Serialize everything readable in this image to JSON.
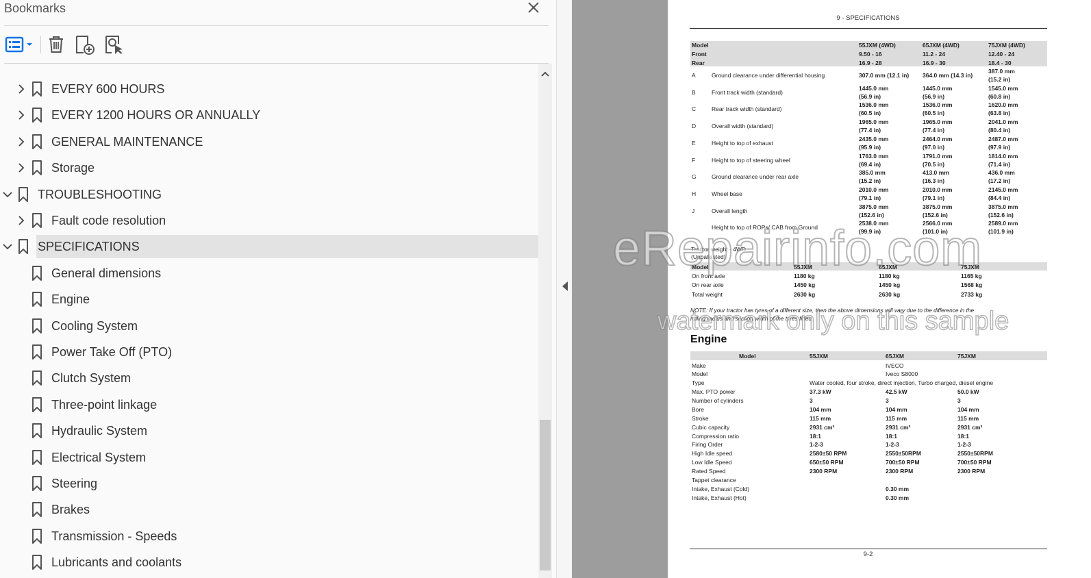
{
  "panel": {
    "title": "Bookmarks",
    "toolbar": {
      "options_icon": "list-options-icon",
      "delete_icon": "trash-icon",
      "new_bookmark_icon": "add-bookmark-icon",
      "find_bookmark_icon": "find-bookmark-icon"
    }
  },
  "bookmarks": [
    {
      "label": "EVERY 600 HOURS",
      "level": 1,
      "expandable": true,
      "expanded": false
    },
    {
      "label": "EVERY 1200 HOURS OR ANNUALLY",
      "level": 1,
      "expandable": true,
      "expanded": false
    },
    {
      "label": "GENERAL MAINTENANCE",
      "level": 1,
      "expandable": true,
      "expanded": false
    },
    {
      "label": "Storage",
      "level": 1,
      "expandable": true,
      "expanded": false
    },
    {
      "label": "TROUBLESHOOTING",
      "level": 0,
      "expandable": true,
      "expanded": true
    },
    {
      "label": "Fault code resolution",
      "level": 1,
      "expandable": true,
      "expanded": false
    },
    {
      "label": "SPECIFICATIONS",
      "level": 0,
      "expandable": true,
      "expanded": true,
      "selected": true
    },
    {
      "label": "General dimensions",
      "level": 1,
      "expandable": false
    },
    {
      "label": "Engine",
      "level": 1,
      "expandable": false
    },
    {
      "label": "Cooling System",
      "level": 1,
      "expandable": false
    },
    {
      "label": "Power Take Off (PTO)",
      "level": 1,
      "expandable": false
    },
    {
      "label": "Clutch System",
      "level": 1,
      "expandable": false
    },
    {
      "label": "Three-point linkage",
      "level": 1,
      "expandable": false
    },
    {
      "label": "Hydraulic System",
      "level": 1,
      "expandable": false
    },
    {
      "label": "Electrical System",
      "level": 1,
      "expandable": false
    },
    {
      "label": "Steering",
      "level": 1,
      "expandable": false
    },
    {
      "label": "Brakes",
      "level": 1,
      "expandable": false
    },
    {
      "label": "Transmission - Speeds",
      "level": 1,
      "expandable": false
    },
    {
      "label": "Lubricants and coolants",
      "level": 1,
      "expandable": false
    }
  ],
  "document": {
    "header": "9 - SPECIFICATIONS",
    "footer": "9-2",
    "dimensions": {
      "head_rows": [
        [
          "Model",
          "55JXM (4WD)",
          "65JXM (4WD)",
          "75JXM (4WD)"
        ],
        [
          "Front",
          "9.50 - 16",
          "11.2 - 24",
          "12.40 - 24"
        ],
        [
          "Rear",
          "16.9 - 28",
          "16.9 - 30",
          "18.4 - 30"
        ]
      ],
      "rows": [
        {
          "key": "A",
          "name": "Ground clearance under differential housing",
          "v1": "307.0 mm (12.1 in)",
          "v2": "364.0 mm (14.3 in)",
          "v3": "387.0 mm",
          "v3b": "(15.2 in)"
        },
        {
          "key": "B",
          "name": "Front track width (standard)",
          "v1": "1445.0 mm",
          "v1b": "(56.9 in)",
          "v2": "1445.0 mm",
          "v2b": "(56.9 in)",
          "v3": "1545.0 mm",
          "v3b": "(60.8 in)"
        },
        {
          "key": "C",
          "name": "Rear track width (standard)",
          "v1": "1536.0 mm",
          "v1b": "(60.5 in)",
          "v2": "1536.0 mm",
          "v2b": "(60.5 in)",
          "v3": "1620.0 mm",
          "v3b": "(63.8 in)"
        },
        {
          "key": "D",
          "name": "Overall width (standard)",
          "v1": "1965.0 mm",
          "v1b": "(77.4 in)",
          "v2": "1965.0 mm",
          "v2b": "(77.4 in)",
          "v3": "2041.0 mm",
          "v3b": "(80.4 in)"
        },
        {
          "key": "E",
          "name": "Height to top of exhaust",
          "v1": "2435.0 mm",
          "v1b": "(95.9 in)",
          "v2": "2464.0 mm",
          "v2b": "(97.0 in)",
          "v3": "2487.0 mm",
          "v3b": "(97.9 in)"
        },
        {
          "key": "F",
          "name": "Height to top of steering wheel",
          "v1": "1763.0 mm",
          "v1b": "(69.4 in)",
          "v2": "1791.0 mm",
          "v2b": "(70.5 in)",
          "v3": "1814.0 mm",
          "v3b": "(71.4 in)"
        },
        {
          "key": "G",
          "name": "Ground clearance under rear axle",
          "v1": "385.0 mm",
          "v1b": "(15.2 in)",
          "v2": "413.0 mm",
          "v2b": "(16.3 in)",
          "v3": "436.0 mm",
          "v3b": "(17.2 in)"
        },
        {
          "key": "H",
          "name": "Wheel base",
          "v1": "2010.0 mm",
          "v1b": "(79.1 in)",
          "v2": "2010.0 mm",
          "v2b": "(79.1 in)",
          "v3": "2145.0 mm",
          "v3b": "(84.4 in)"
        },
        {
          "key": "J",
          "name": "Overall length",
          "v1": "3875.0 mm",
          "v1b": "(152.6 in)",
          "v2": "3875.0 mm",
          "v2b": "(152.6 in)",
          "v3": "3875.0 mm",
          "v3b": "(152.6 in)"
        },
        {
          "key": "",
          "name": "Height to top of ROPs/ CAB from Ground",
          "v1": "2538.0 mm",
          "v1b": "(99.9 in)",
          "v2": "2566.0 mm",
          "v2b": "(101.0 in)",
          "v3": "2589.0 mm",
          "v3b": "(101.9 in)"
        }
      ]
    },
    "weight": {
      "title1": "Tractor weight - 4WD",
      "title2": "(Unballasted)",
      "header": [
        "Model",
        "55JXM",
        "65JXM",
        "75JXM"
      ],
      "rows": [
        [
          "On front axle",
          "1180 kg",
          "1180 kg",
          "1165 kg"
        ],
        [
          "On rear axle",
          "1450 kg",
          "1450 kg",
          "1568 kg"
        ],
        [
          "Total weight",
          "2630 kg",
          "2630 kg",
          "2733 kg"
        ]
      ]
    },
    "note_line1": "NOTE: If your tractor has tyres of a different size, then the above dimensions will vary due to the difference in the",
    "note_line2": "rolling radius and section width of the tyres fitted.",
    "engine": {
      "heading": "Engine",
      "header": [
        "Model",
        "55JXM",
        "65JXM",
        "75JXM"
      ],
      "make_label": "Make",
      "make_value": "IVECO",
      "model_label": "Model",
      "model_value": "Iveco S8000",
      "type_label": "Type",
      "type_value": "Water cooled, four stroke, direct injection, Turbo charged, diesel engine",
      "rows": [
        [
          "Max. PTO power",
          "37.3 kW",
          "42.5 kW",
          "50.0 kW"
        ],
        [
          "Number of cylinders",
          "3",
          "3",
          "3"
        ],
        [
          "Bore",
          "104 mm",
          "104 mm",
          "104 mm"
        ],
        [
          "Stroke",
          "115 mm",
          "115 mm",
          "115 mm"
        ],
        [
          "Cubic capacity",
          "2931 cm³",
          "2931 cm³",
          "2931 cm³"
        ],
        [
          "Compression ratio",
          "18:1",
          "18:1",
          "18:1"
        ],
        [
          "Firing Order",
          "1-2-3",
          "1-2-3",
          "1-2-3"
        ],
        [
          "High Idle speed",
          "2580±50 RPM",
          "2550±50RPM",
          "2550±50RPM"
        ],
        [
          "Low Idle Speed",
          "650±50 RPM",
          "700±50 RPM",
          "700±50 RPM"
        ],
        [
          "Rated Speed",
          "2300 RPM",
          "2300 RPM",
          "2300 RPM"
        ]
      ],
      "tappet_label": "Tappet clearance",
      "tappet_cold_label": "Intake, Exhaust (Cold)",
      "tappet_cold_value": "0.30 mm",
      "tappet_hot_label": "Intake, Exhaust (Hot)",
      "tappet_hot_value": "0.30 mm"
    },
    "watermark_line1": "eRepairinfo.com",
    "watermark_line2": "watermark only on this sample"
  }
}
